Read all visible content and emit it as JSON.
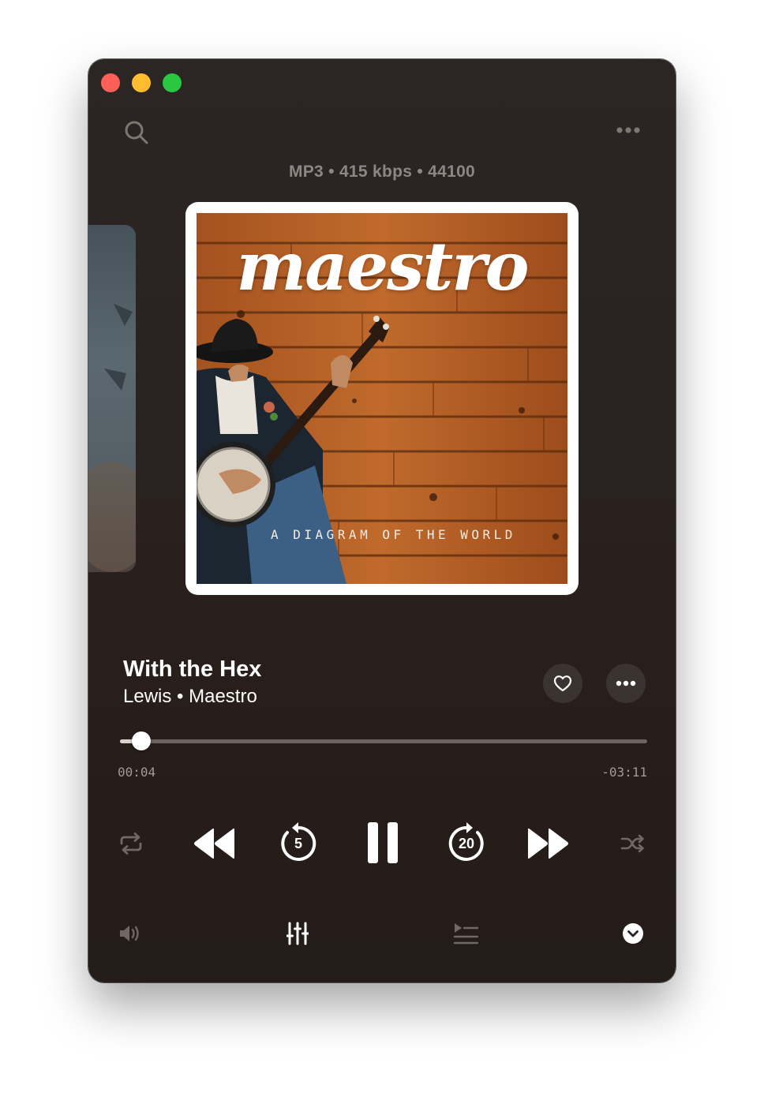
{
  "window": {
    "traffic_lights": [
      "close",
      "minimize",
      "zoom"
    ]
  },
  "header": {
    "search_icon": "search-icon",
    "more_icon": "more-horizontal-icon"
  },
  "format_info": "MP3 • 415 kbps • 44100",
  "album_art": {
    "title": "maestro",
    "subtitle": "A DIAGRAM OF THE WORLD"
  },
  "track": {
    "title": "With the Hex",
    "subtitle": "Lewis • Maestro"
  },
  "playback": {
    "elapsed": "00:04",
    "remaining": "-03:11",
    "progress_fraction": 0.04,
    "state": "playing"
  },
  "controls": {
    "repeat": "repeat-icon",
    "previous": "rewind-icon",
    "skip_back_seconds": "5",
    "play_pause": "pause-icon",
    "skip_forward_seconds": "20",
    "next": "fast-forward-icon",
    "shuffle": "shuffle-icon"
  },
  "bottom_bar": {
    "volume": "volume-icon",
    "equalizer": "equalizer-icon",
    "queue": "queue-icon",
    "collapse": "chevron-down-icon"
  },
  "colors": {
    "close": "#fe5f57",
    "minimize": "#febc2e",
    "zoom": "#28c840",
    "background": "#2a2220"
  }
}
